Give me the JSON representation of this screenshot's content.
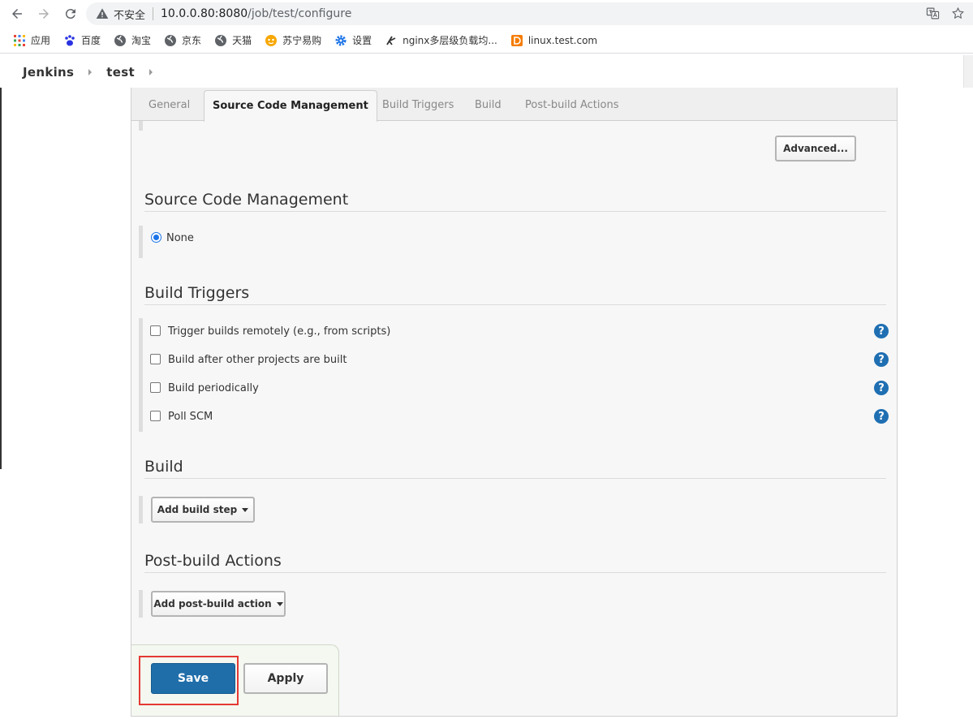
{
  "browser": {
    "security_label": "不安全",
    "url_host": "10.0.0.80:8080",
    "url_path": "/job/test/configure",
    "bookmarks": [
      {
        "label": "应用",
        "icon": "apps-grid-icon"
      },
      {
        "label": "百度",
        "icon": "baidu-paw-icon"
      },
      {
        "label": "淘宝",
        "icon": "globe-icon"
      },
      {
        "label": "京东",
        "icon": "globe-icon"
      },
      {
        "label": "天猫",
        "icon": "globe-icon"
      },
      {
        "label": "苏宁易购",
        "icon": "suning-icon"
      },
      {
        "label": "设置",
        "icon": "gear-icon"
      },
      {
        "label": "nginx多层级负载均...",
        "icon": "nginx-bookmark-icon"
      },
      {
        "label": "linux.test.com",
        "icon": "d-logo-icon"
      }
    ]
  },
  "breadcrumb": {
    "items": [
      "Jenkins",
      "test"
    ]
  },
  "tabs": [
    "General",
    "Source Code Management",
    "Build Triggers",
    "Build",
    "Post-build Actions"
  ],
  "active_tab": "Source Code Management",
  "general": {
    "advanced_button": "Advanced..."
  },
  "scm": {
    "title": "Source Code Management",
    "options": [
      {
        "label": "None",
        "selected": true
      }
    ]
  },
  "build_triggers": {
    "title": "Build Triggers",
    "options": [
      {
        "label": "Trigger builds remotely (e.g., from scripts)",
        "checked": false
      },
      {
        "label": "Build after other projects are built",
        "checked": false
      },
      {
        "label": "Build periodically",
        "checked": false
      },
      {
        "label": "Poll SCM",
        "checked": false
      }
    ]
  },
  "build": {
    "title": "Build",
    "add_button": "Add build step"
  },
  "post_build": {
    "title": "Post-build Actions",
    "add_button": "Add post-build action"
  },
  "actions": {
    "save": "Save",
    "apply": "Apply"
  },
  "colors": {
    "primary": "#1f6eaa",
    "help_icon": "#1f6fb2",
    "highlight_border": "#e53935"
  }
}
